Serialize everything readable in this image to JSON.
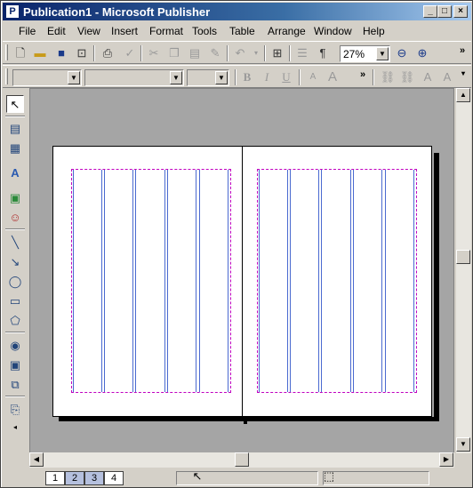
{
  "window": {
    "title": "Publication1 - Microsoft Publisher",
    "app_icon": "P"
  },
  "controls": {
    "minimize": "_",
    "maximize": "□",
    "close": "×"
  },
  "menu": [
    "File",
    "Edit",
    "View",
    "Insert",
    "Format",
    "Tools",
    "Table",
    "Arrange",
    "Window",
    "Help"
  ],
  "standard_toolbar": {
    "zoom": "27%",
    "icons": [
      "new-icon",
      "open-icon",
      "save-icon",
      "print-preview-icon",
      "print-icon",
      "spelling-icon",
      "cut-icon",
      "copy-icon",
      "paste-icon",
      "format-painter-icon",
      "undo-icon",
      "redo-icon",
      "insert-object-icon",
      "columns-icon",
      "special-characters-icon",
      "zoom-out-icon",
      "zoom-in-icon"
    ]
  },
  "formatting_toolbar": {
    "style": "",
    "font": "",
    "font_size": "",
    "bold": "B",
    "italic": "I",
    "underline": "U"
  },
  "object_tools": [
    "pointer",
    "text-box",
    "table",
    "wordart",
    "picture",
    "clip-art",
    "line",
    "arrow",
    "oval",
    "rectangle",
    "autoshapes",
    "hot-spot",
    "form-control",
    "html-fragment",
    "design-gallery"
  ],
  "pages": [
    "1",
    "2",
    "3",
    "4"
  ],
  "active_pages": [
    "2",
    "3"
  ],
  "layout": {
    "columns_per_page": 5
  }
}
